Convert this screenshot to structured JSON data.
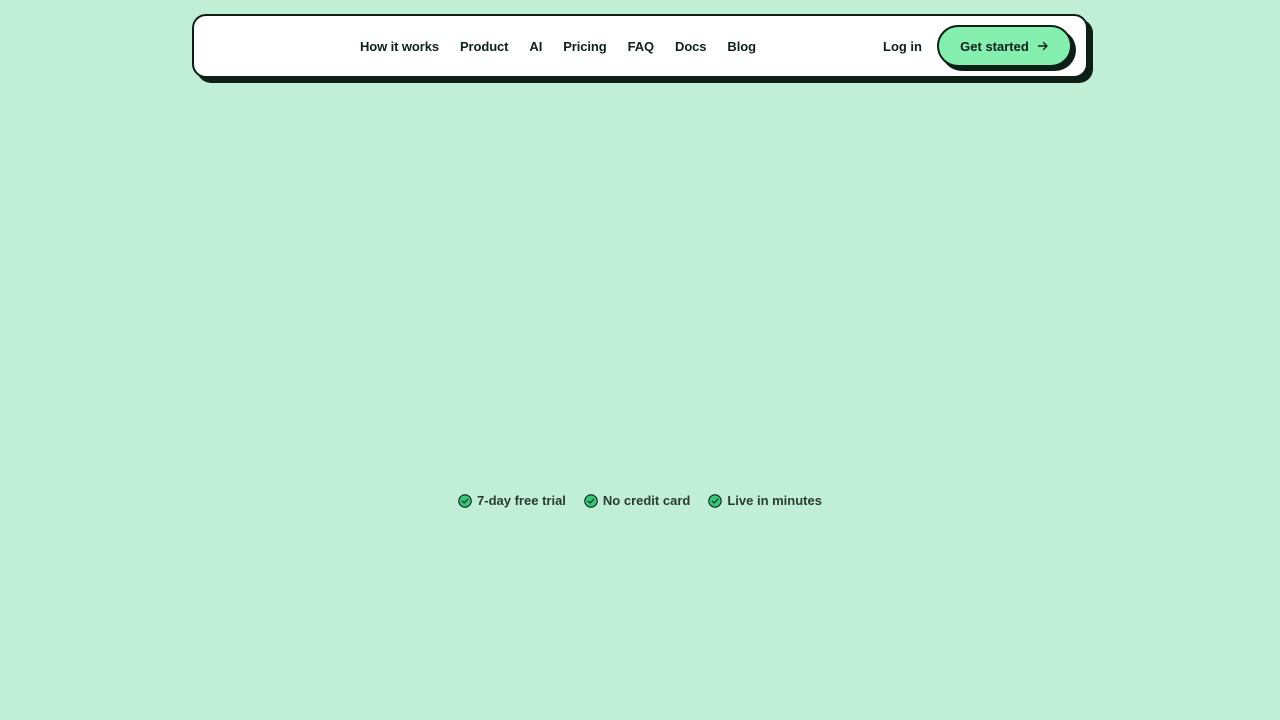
{
  "nav": {
    "links": [
      {
        "label": "How it works"
      },
      {
        "label": "Product"
      },
      {
        "label": "AI"
      },
      {
        "label": "Pricing"
      },
      {
        "label": "FAQ"
      },
      {
        "label": "Docs"
      },
      {
        "label": "Blog"
      }
    ],
    "login_label": "Log in",
    "cta_label": "Get started",
    "cta_icon": "arrow-right-icon"
  },
  "badges": [
    {
      "label": "7-day free trial",
      "icon": "check-circle-icon"
    },
    {
      "label": "No credit card",
      "icon": "check-circle-icon"
    },
    {
      "label": "Live in minutes",
      "icon": "check-circle-icon"
    }
  ],
  "colors": {
    "background": "#c1eed6",
    "accent": "#84efaf",
    "ink": "#0d1f17",
    "badge_check": "#34c77b"
  }
}
